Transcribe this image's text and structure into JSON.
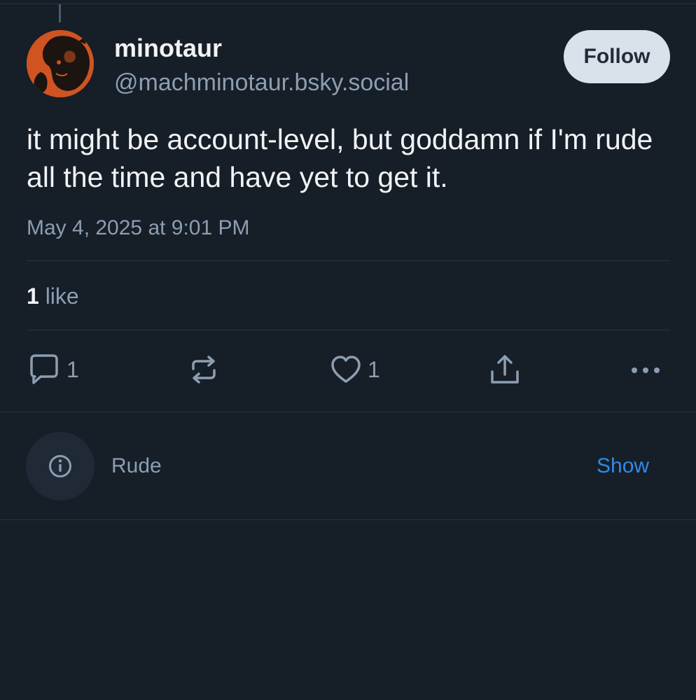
{
  "post": {
    "author": {
      "display_name": "minotaur",
      "handle": "@machminotaur.bsky.social",
      "avatar_icon": "minotaur-vase-avatar"
    },
    "follow_label": "Follow",
    "text": "it might be account-level, but goddamn if I'm rude all the time and have yet to get it.",
    "timestamp": "May 4, 2025 at 9:01 PM",
    "likes": {
      "count": "1",
      "label": "like"
    },
    "actions": {
      "reply": {
        "icon": "reply-icon",
        "count": "1"
      },
      "repost": {
        "icon": "repost-icon"
      },
      "like": {
        "icon": "heart-icon",
        "count": "1"
      },
      "share": {
        "icon": "share-icon"
      },
      "more": {
        "icon": "more-icon"
      }
    }
  },
  "moderation_label": {
    "icon": "info-icon",
    "text": "Rude",
    "action_label": "Show"
  },
  "colors": {
    "background": "#161e27",
    "text_primary": "#f1f3f5",
    "text_secondary": "#8c9eb2",
    "accent_link": "#2f8ae8",
    "follow_button_bg": "#d9e1ea"
  }
}
